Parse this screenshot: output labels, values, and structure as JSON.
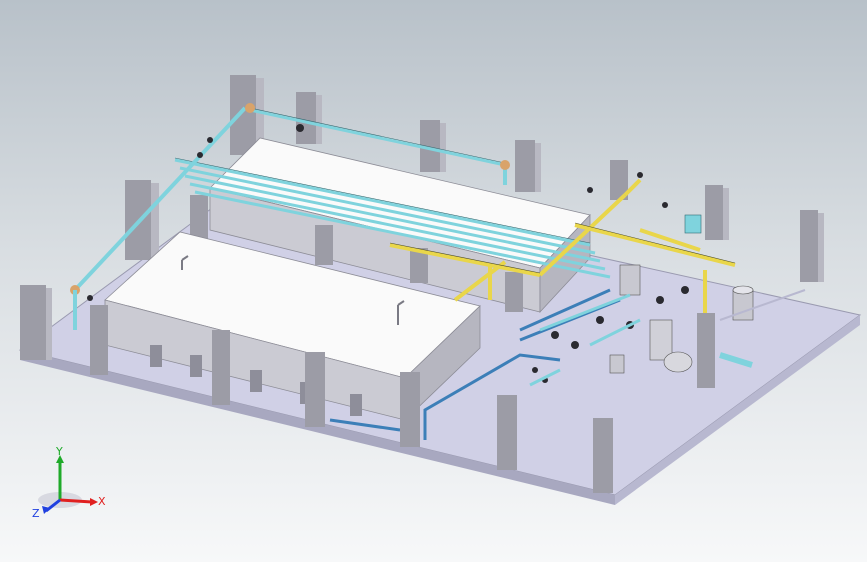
{
  "viewport": {
    "background_top": "#b8c1c9",
    "background_bottom": "#f7f8f9"
  },
  "colors": {
    "pipe_cyan": "#7fd3dd",
    "pipe_yellow": "#e9d64a",
    "pipe_blue": "#3c7fb8",
    "elbow_orange": "#d9a36a",
    "tank_top": "#fafafa",
    "tank_side": "#cbcbd3",
    "pillar_front": "#9c9ca6",
    "pillar_side": "#b8b8c2",
    "slab": "#d0d0e6"
  },
  "triad": {
    "x_label": "X",
    "y_label": "Y",
    "z_label": "Z",
    "x_color": "#e02020",
    "y_color": "#1faa2a",
    "z_color": "#2040e0"
  }
}
